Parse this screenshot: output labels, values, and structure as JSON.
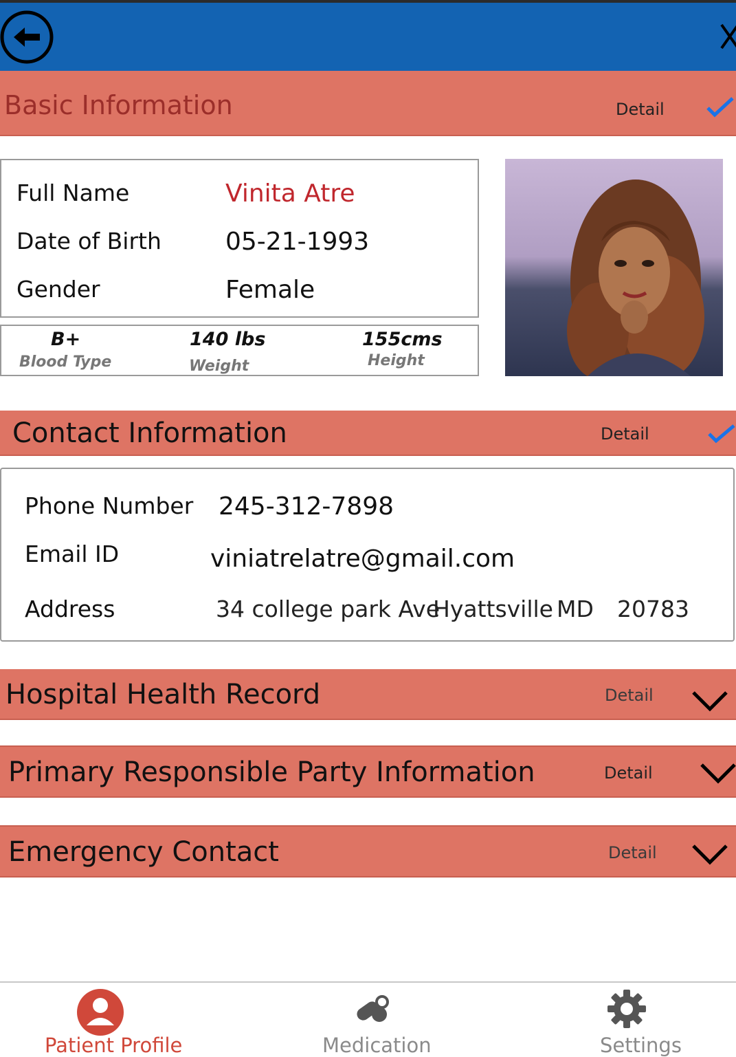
{
  "colors": {
    "top_bar": "#1363b2",
    "section_header": "#de7464",
    "name_accent": "#c0272d",
    "check": "#1a73e8",
    "nav_active": "#d0483a",
    "nav_inactive": "#8a8a8a"
  },
  "top_bar": {
    "back_icon": "back-arrow-icon",
    "close_icon": "close-icon"
  },
  "sections": {
    "basic": {
      "title": "Basic Information",
      "detail": "Detail",
      "icon": "checkmark-icon"
    },
    "contact": {
      "title": "Contact Information",
      "detail": "Detail",
      "icon": "checkmark-icon"
    },
    "hospital": {
      "title": "Hospital Health Record",
      "detail": "Detail",
      "icon": "chevron-down-icon"
    },
    "responsible": {
      "title": "Primary Responsible Party Information",
      "detail": "Detail",
      "icon": "chevron-down-icon"
    },
    "emergency": {
      "title": "Emergency Contact",
      "detail": "Detail",
      "icon": "chevron-down-icon"
    }
  },
  "basic_info": {
    "full_name_label": "Full Name",
    "full_name": "Vinita Atre",
    "dob_label": "Date of Birth",
    "dob": "05-21-1993",
    "gender_label": "Gender",
    "gender": "Female"
  },
  "vitals": {
    "blood_type": "B+",
    "blood_type_label": "Blood Type",
    "weight": "140 lbs",
    "weight_label": "Weight",
    "height": "155cms",
    "height_label": "Height"
  },
  "contact_info": {
    "phone_label": "Phone Number",
    "phone": "245-312-7898",
    "email_label": "Email ID",
    "email": "viniatrelatre@gmail.com",
    "address_label": "Address",
    "street": "34 college park Ave",
    "city": "Hyattsville",
    "state": "MD",
    "zip": "20783"
  },
  "bottom_nav": {
    "items": [
      {
        "label": "Patient Profile",
        "icon": "user-icon",
        "active": true
      },
      {
        "label": "Medication",
        "icon": "pills-icon",
        "active": false
      },
      {
        "label": "Settings",
        "icon": "gear-icon",
        "active": false
      }
    ]
  }
}
